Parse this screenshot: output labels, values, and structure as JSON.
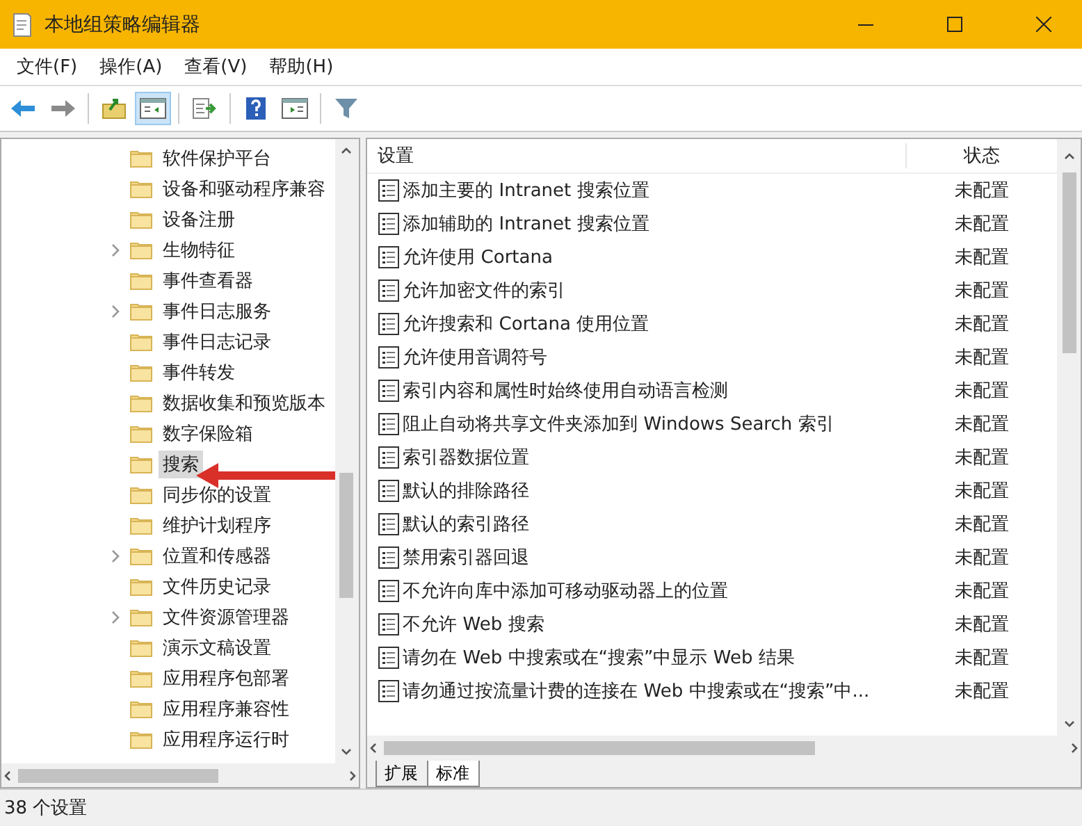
{
  "window": {
    "title": "本地组策略编辑器"
  },
  "menu": [
    "文件(F)",
    "操作(A)",
    "查看(V)",
    "帮助(H)"
  ],
  "tree": {
    "items": [
      {
        "label": "软件保护平台",
        "expandable": false,
        "selected": false
      },
      {
        "label": "设备和驱动程序兼容",
        "expandable": false,
        "selected": false
      },
      {
        "label": "设备注册",
        "expandable": false,
        "selected": false
      },
      {
        "label": "生物特征",
        "expandable": true,
        "selected": false
      },
      {
        "label": "事件查看器",
        "expandable": false,
        "selected": false
      },
      {
        "label": "事件日志服务",
        "expandable": true,
        "selected": false
      },
      {
        "label": "事件日志记录",
        "expandable": false,
        "selected": false
      },
      {
        "label": "事件转发",
        "expandable": false,
        "selected": false
      },
      {
        "label": "数据收集和预览版本",
        "expandable": false,
        "selected": false
      },
      {
        "label": "数字保险箱",
        "expandable": false,
        "selected": false
      },
      {
        "label": "搜索",
        "expandable": false,
        "selected": true
      },
      {
        "label": "同步你的设置",
        "expandable": false,
        "selected": false
      },
      {
        "label": "维护计划程序",
        "expandable": false,
        "selected": false
      },
      {
        "label": "位置和传感器",
        "expandable": true,
        "selected": false
      },
      {
        "label": "文件历史记录",
        "expandable": false,
        "selected": false
      },
      {
        "label": "文件资源管理器",
        "expandable": true,
        "selected": false
      },
      {
        "label": "演示文稿设置",
        "expandable": false,
        "selected": false
      },
      {
        "label": "应用程序包部署",
        "expandable": false,
        "selected": false
      },
      {
        "label": "应用程序兼容性",
        "expandable": false,
        "selected": false
      },
      {
        "label": "应用程序运行时",
        "expandable": false,
        "selected": false
      }
    ]
  },
  "settings": {
    "columns": [
      "设置",
      "状态"
    ],
    "rows": [
      {
        "name": "添加主要的 Intranet 搜索位置",
        "state": "未配置"
      },
      {
        "name": "添加辅助的 Intranet 搜索位置",
        "state": "未配置"
      },
      {
        "name": "允许使用 Cortana",
        "state": "未配置"
      },
      {
        "name": "允许加密文件的索引",
        "state": "未配置"
      },
      {
        "name": "允许搜索和 Cortana 使用位置",
        "state": "未配置"
      },
      {
        "name": "允许使用音调符号",
        "state": "未配置"
      },
      {
        "name": "索引内容和属性时始终使用自动语言检测",
        "state": "未配置"
      },
      {
        "name": "阻止自动将共享文件夹添加到 Windows Search 索引",
        "state": "未配置"
      },
      {
        "name": "索引器数据位置",
        "state": "未配置"
      },
      {
        "name": "默认的排除路径",
        "state": "未配置"
      },
      {
        "name": "默认的索引路径",
        "state": "未配置"
      },
      {
        "name": "禁用索引器回退",
        "state": "未配置"
      },
      {
        "name": "不允许向库中添加可移动驱动器上的位置",
        "state": "未配置"
      },
      {
        "name": "不允许 Web 搜索",
        "state": "未配置"
      },
      {
        "name": "请勿在 Web 中搜索或在“搜索”中显示 Web 结果",
        "state": "未配置"
      },
      {
        "name": "请勿通过按流量计费的连接在 Web 中搜索或在“搜索”中...",
        "state": "未配置"
      }
    ]
  },
  "tabs": [
    {
      "label": "扩展",
      "selected": false
    },
    {
      "label": "标准",
      "selected": true
    }
  ],
  "status_bar": "38 个设置"
}
